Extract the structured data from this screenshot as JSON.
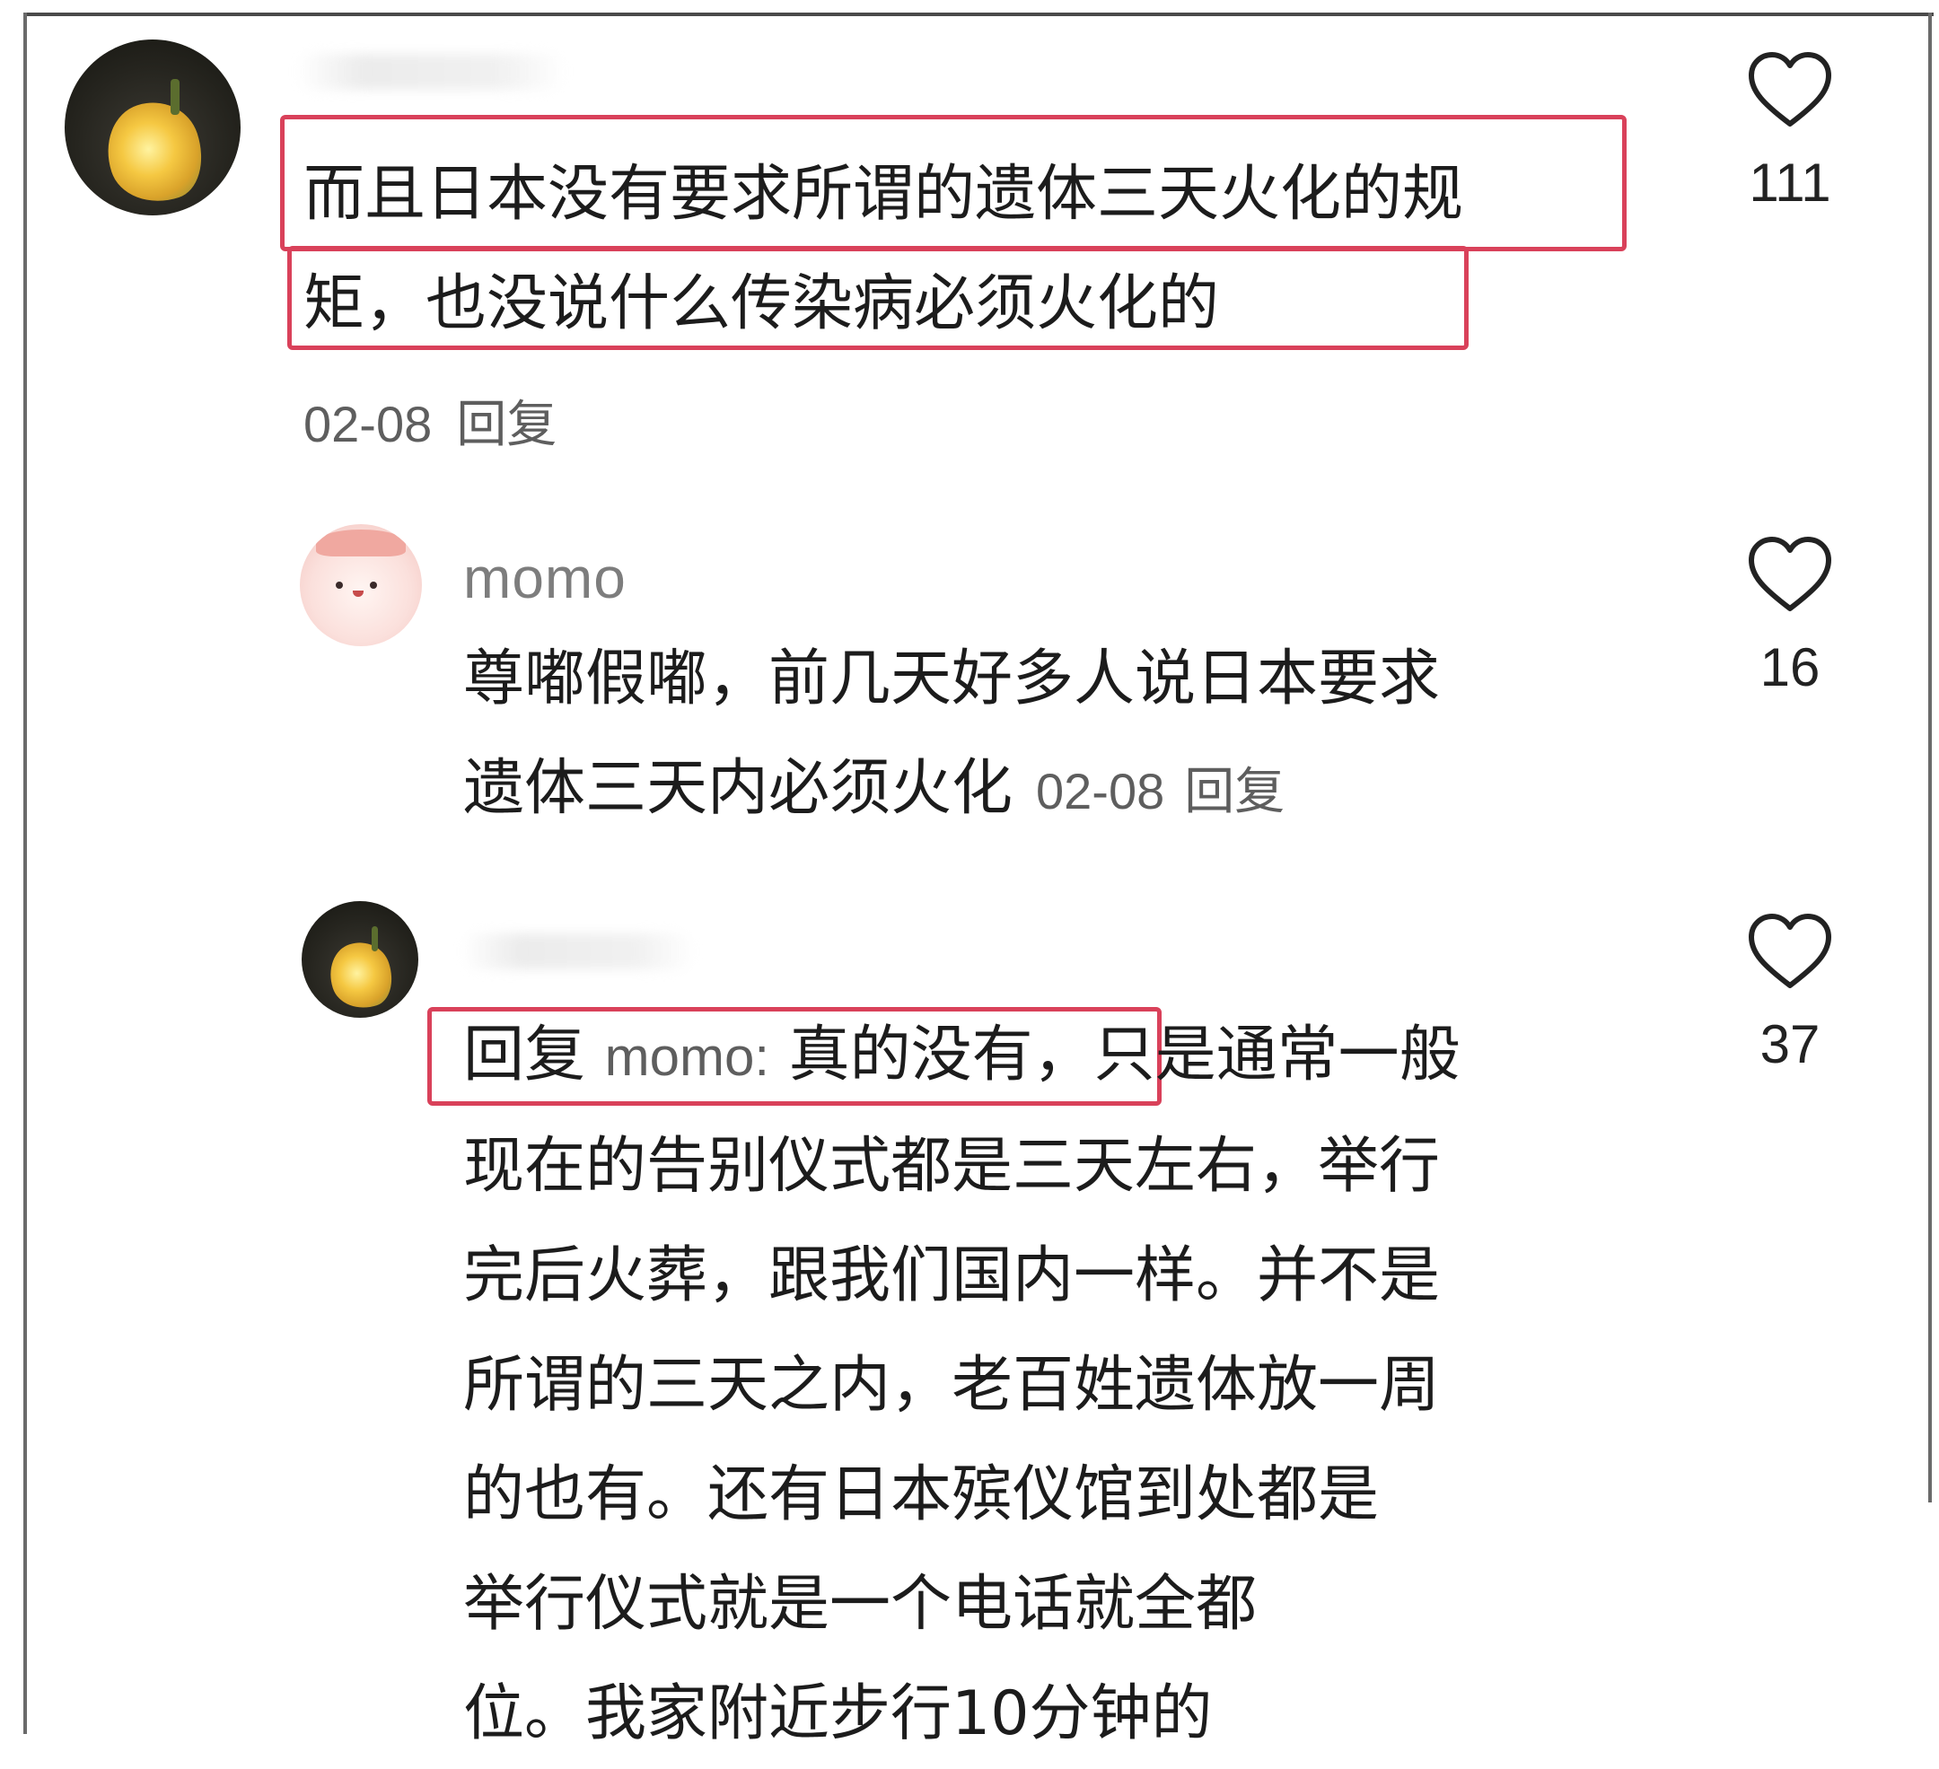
{
  "comments": [
    {
      "username": "",
      "lines": [
        "而且日本没有要求所谓的遗体三天火化的规",
        "矩，也没说什么传染病必须火化的"
      ],
      "date": "02-08",
      "reply_label": "回复",
      "likes": "111"
    },
    {
      "username": "momo",
      "lines": [
        "尊嘟假嘟，前几天好多人说日本要求",
        "遗体三天内必须火化"
      ],
      "date": "02-08",
      "reply_label": "回复",
      "likes": "16"
    },
    {
      "username": "",
      "reply_prefix": "回复",
      "mention": "momo:",
      "first_line_highlight": "真的没有",
      "first_line_rest": "，只是通常一般",
      "lines": [
        "现在的告别仪式都是三天左右，举行",
        "完后火葬，跟我们国内一样。并不是",
        "所谓的三天之内，老百姓遗体放一周",
        "的也有。还有日本殡仪馆到处都是",
        "举行仪式就是一个电话就全都",
        "位。我家附近步行10分钟的"
      ],
      "likes": "37"
    }
  ],
  "colors": {
    "highlight": "#d9415a",
    "text": "#1c1c1c",
    "meta": "#5e5e5e"
  },
  "icons": {
    "like": "heart-outline-icon"
  }
}
